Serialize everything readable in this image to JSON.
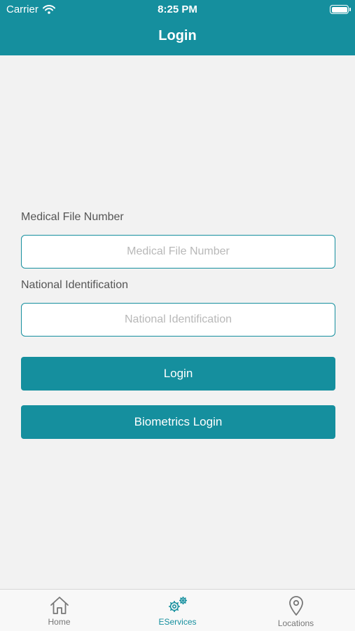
{
  "status": {
    "carrier": "Carrier",
    "time": "8:25 PM"
  },
  "header": {
    "title": "Login"
  },
  "form": {
    "medical_label": "Medical File Number",
    "medical_placeholder": "Medical File Number",
    "medical_value": "",
    "national_label": "National Identification",
    "national_placeholder": "National Identification",
    "national_value": ""
  },
  "buttons": {
    "login": "Login",
    "biometrics": "Biometrics Login"
  },
  "tabs": [
    {
      "label": "Home",
      "icon": "home-icon",
      "active": false
    },
    {
      "label": "EServices",
      "icon": "gears-icon",
      "active": true
    },
    {
      "label": "Locations",
      "icon": "location-pin-icon",
      "active": false
    }
  ],
  "colors": {
    "accent": "#158f9e",
    "background": "#f2f2f2",
    "tab_inactive": "#777777"
  }
}
